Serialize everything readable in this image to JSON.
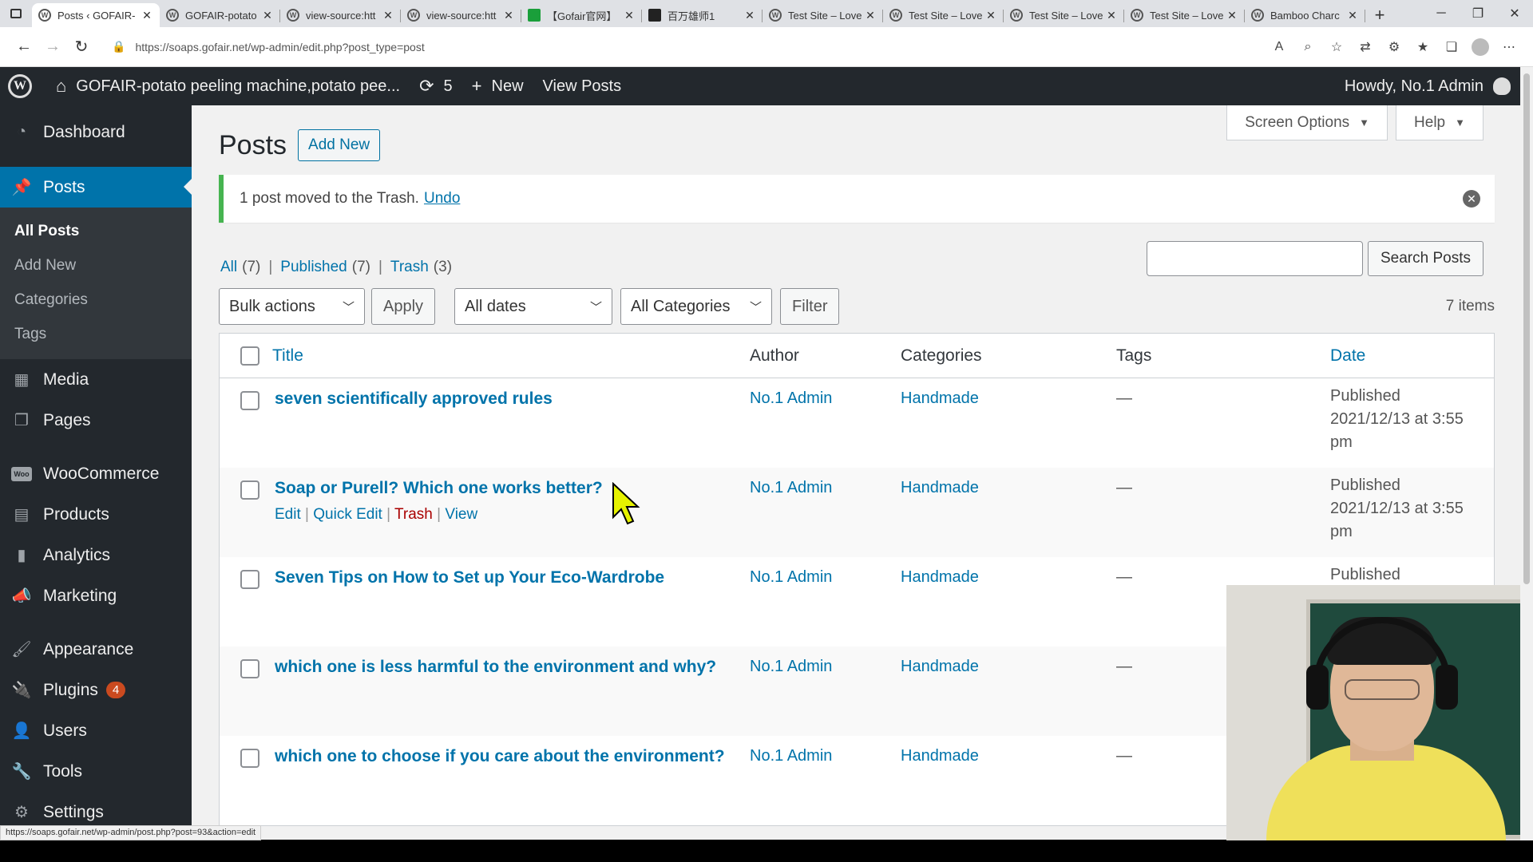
{
  "browser": {
    "tabs": [
      {
        "title": "Posts ‹ GOFAIR-",
        "icon": "wordpress",
        "active": true
      },
      {
        "title": "GOFAIR-potato",
        "icon": "wordpress"
      },
      {
        "title": "view-source:htt",
        "icon": "wordpress"
      },
      {
        "title": "view-source:htt",
        "icon": "wordpress"
      },
      {
        "title": "【Gofair官网】",
        "icon": "green"
      },
      {
        "title": "百万雄师1",
        "icon": "bt"
      },
      {
        "title": "Test Site – Love",
        "icon": "wordpress"
      },
      {
        "title": "Test Site – Love",
        "icon": "wordpress"
      },
      {
        "title": "Test Site – Love",
        "icon": "wordpress"
      },
      {
        "title": "Test Site – Love",
        "icon": "wordpress"
      },
      {
        "title": "Bamboo Charc",
        "icon": "wordpress"
      }
    ],
    "url": "https://soaps.gofair.net/wp-admin/edit.php?post_type=post",
    "status_url": "https://soaps.gofair.net/wp-admin/post.php?post=93&action=edit"
  },
  "adminbar": {
    "site_name": "GOFAIR-potato peeling machine,potato pee...",
    "updates_count": "5",
    "new_label": "New",
    "view_posts": "View Posts",
    "howdy": "Howdy, No.1 Admin"
  },
  "menu": {
    "dashboard": "Dashboard",
    "posts": "Posts",
    "sub": {
      "all": "All Posts",
      "add": "Add New",
      "categories": "Categories",
      "tags": "Tags"
    },
    "media": "Media",
    "pages": "Pages",
    "woocommerce": "WooCommerce",
    "woo_icon_text": "Woo",
    "products": "Products",
    "analytics": "Analytics",
    "marketing": "Marketing",
    "appearance": "Appearance",
    "plugins": "Plugins",
    "plugins_badge": "4",
    "users": "Users",
    "tools": "Tools",
    "settings": "Settings"
  },
  "page": {
    "screen_options": "Screen Options",
    "help": "Help",
    "title": "Posts",
    "add_new": "Add New",
    "notice": "1 post moved to the Trash.",
    "undo": "Undo",
    "filters": {
      "all": "All",
      "all_count": "(7)",
      "published": "Published",
      "published_count": "(7)",
      "trash": "Trash",
      "trash_count": "(3)"
    },
    "search_button": "Search Posts",
    "bulk_actions": "Bulk actions",
    "apply": "Apply",
    "all_dates": "All dates",
    "all_categories": "All Categories",
    "filter": "Filter",
    "items_count": "7 items"
  },
  "table": {
    "headers": {
      "title": "Title",
      "author": "Author",
      "categories": "Categories",
      "tags": "Tags",
      "date": "Date"
    },
    "row_actions": {
      "edit": "Edit",
      "quick_edit": "Quick Edit",
      "trash": "Trash",
      "view": "View"
    },
    "rows": [
      {
        "title": "seven scientifically approved rules",
        "author": "No.1 Admin",
        "category": "Handmade",
        "tags": "—",
        "status": "Published",
        "date": "2021/12/13 at 3:55",
        "time_suffix": "pm"
      },
      {
        "title": "Soap or Purell? Which one works better?",
        "author": "No.1 Admin",
        "category": "Handmade",
        "tags": "—",
        "status": "Published",
        "date": "2021/12/13 at 3:55",
        "time_suffix": "pm"
      },
      {
        "title": "Seven Tips on How to Set up Your Eco-Wardrobe",
        "author": "No.1 Admin",
        "category": "Handmade",
        "tags": "—",
        "status": "Published",
        "date": "",
        "time_suffix": ""
      },
      {
        "title": "which one is less harmful to the environment and why?",
        "author": "No.1 Admin",
        "category": "Handmade",
        "tags": "—",
        "status": "",
        "date": "",
        "time_suffix": ""
      },
      {
        "title": "which one to choose if you care about the environment?",
        "author": "No.1 Admin",
        "category": "Handmade",
        "tags": "—",
        "status": "",
        "date": "",
        "time_suffix": ""
      }
    ]
  }
}
